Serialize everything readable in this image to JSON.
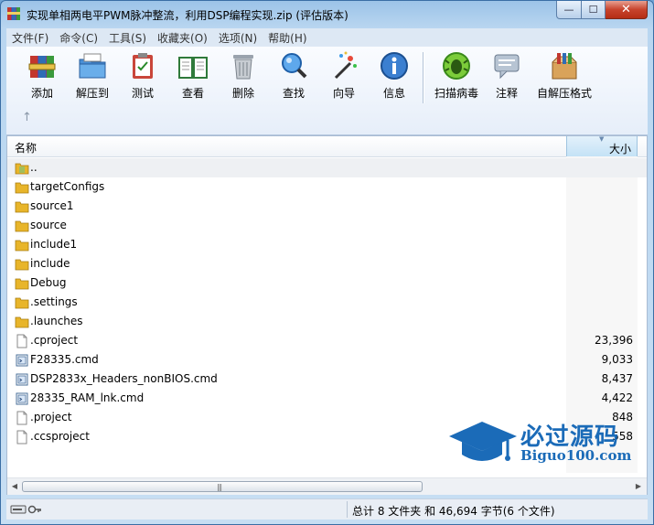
{
  "window": {
    "title": "实现单相两电平PWM脉冲整流，利用DSP编程实现.zip (评估版本)",
    "buttons": {
      "minimize": "—",
      "maximize": "☐",
      "close": "✕"
    }
  },
  "menu": [
    "文件(F)",
    "命令(C)",
    "工具(S)",
    "收藏夹(O)",
    "选项(N)",
    "帮助(H)"
  ],
  "toolbar": [
    {
      "label": "添加",
      "icon": "add-archive-icon"
    },
    {
      "label": "解压到",
      "icon": "extract-folder-icon"
    },
    {
      "label": "测试",
      "icon": "test-clipboard-icon"
    },
    {
      "label": "查看",
      "icon": "view-book-icon"
    },
    {
      "label": "删除",
      "icon": "trash-icon"
    },
    {
      "label": "查找",
      "icon": "magnifier-icon"
    },
    {
      "label": "向导",
      "icon": "wizard-wand-icon"
    },
    {
      "label": "信息",
      "icon": "info-icon"
    },
    {
      "label": "扫描病毒",
      "icon": "virus-scan-icon"
    },
    {
      "label": "注释",
      "icon": "comment-icon"
    },
    {
      "label": "自解压格式",
      "icon": "sfx-box-icon"
    }
  ],
  "up_button": "↑",
  "columns": {
    "name": "名称",
    "size": "大小"
  },
  "files": [
    {
      "name": "..",
      "size": "",
      "type": "parent"
    },
    {
      "name": "targetConfigs",
      "size": "",
      "type": "folder"
    },
    {
      "name": "source1",
      "size": "",
      "type": "folder"
    },
    {
      "name": "source",
      "size": "",
      "type": "folder"
    },
    {
      "name": "include1",
      "size": "",
      "type": "folder"
    },
    {
      "name": "include",
      "size": "",
      "type": "folder"
    },
    {
      "name": "Debug",
      "size": "",
      "type": "folder"
    },
    {
      "name": ".settings",
      "size": "",
      "type": "folder"
    },
    {
      "name": ".launches",
      "size": "",
      "type": "folder"
    },
    {
      "name": ".cproject",
      "size": "23,396",
      "type": "file"
    },
    {
      "name": "F28335.cmd",
      "size": "9,033",
      "type": "cmd"
    },
    {
      "name": "DSP2833x_Headers_nonBIOS.cmd",
      "size": "8,437",
      "type": "cmd"
    },
    {
      "name": "28335_RAM_lnk.cmd",
      "size": "4,422",
      "type": "cmd"
    },
    {
      "name": ".project",
      "size": "848",
      "type": "file"
    },
    {
      "name": ".ccsproject",
      "size": "558",
      "type": "file"
    }
  ],
  "status": {
    "summary": "总计 8 文件夹 和 46,694 字节(6 个文件)"
  },
  "watermark": {
    "cn": "必过源码",
    "en": "Biguo100.com"
  },
  "colors": {
    "folder": "#e8b52a",
    "accent": "#1b6bb8",
    "selected_column": "#c4e2f6"
  }
}
